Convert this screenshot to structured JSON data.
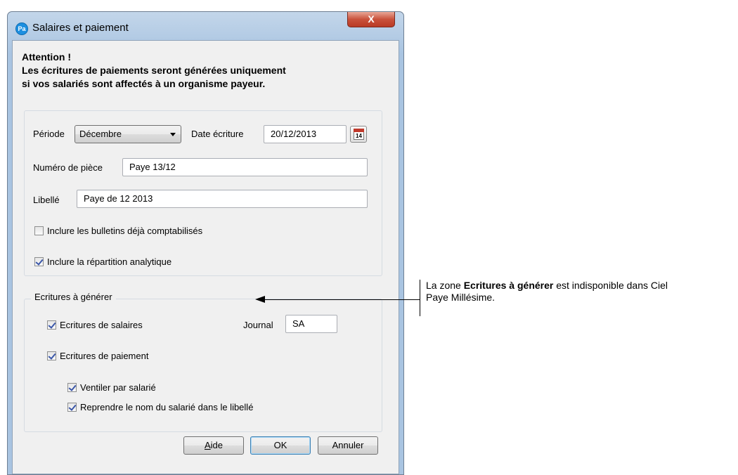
{
  "window": {
    "title": "Salaires et paiement",
    "app_icon": "Pa",
    "close_label": "X"
  },
  "warning": {
    "line1": "Attention !",
    "line2": "Les écritures de paiements seront générées uniquement",
    "line3": "si vos salariés sont affectés à un organisme payeur."
  },
  "form": {
    "periode_label": "Période",
    "periode_value": "Décembre",
    "date_label": "Date écriture",
    "date_value": "20/12/2013",
    "calendar_day": "14",
    "numero_label": "Numéro de pièce",
    "numero_value": "Paye 13/12",
    "libelle_label": "Libellé",
    "libelle_value": "Paye de 12 2013",
    "inclure_bulletins_label": "Inclure les bulletins déjà comptabilisés",
    "inclure_bulletins_checked": false,
    "inclure_repartition_label": "Inclure la répartition analytique",
    "inclure_repartition_checked": true
  },
  "ecritures": {
    "group_label": "Ecritures à générer",
    "salaires_label": "Ecritures de salaires",
    "salaires_checked": true,
    "journal_label": "Journal",
    "journal_value": "SA",
    "paiement_label": "Ecritures de paiement",
    "paiement_checked": true,
    "ventiler_label": "Ventiler par salarié",
    "ventiler_checked": true,
    "reprendre_label": "Reprendre le nom du salarié dans le libellé",
    "reprendre_checked": true
  },
  "buttons": {
    "aide_first": "A",
    "aide_rest": "ide",
    "ok": "OK",
    "annuler": "Annuler"
  },
  "annotation": {
    "prefix": "La zone ",
    "bold": "Ecritures à générer",
    "suffix": " est indisponible dans Ciel",
    "line2": "Paye Millésime."
  }
}
